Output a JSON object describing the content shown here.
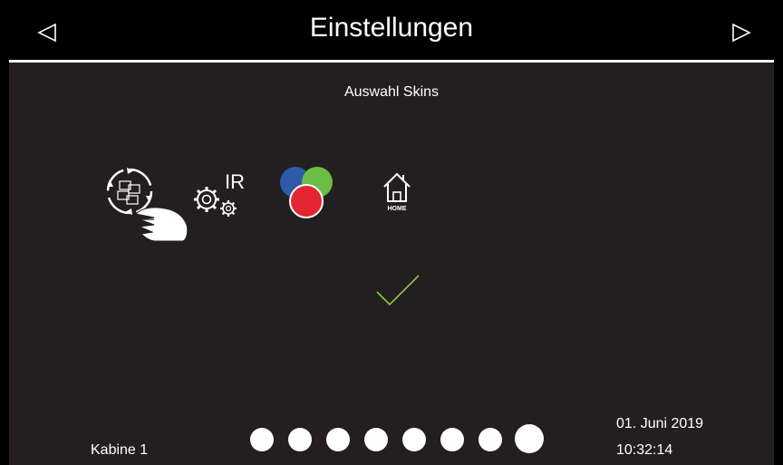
{
  "header": {
    "title": "Einstellungen",
    "prev_icon": "triangle-left-icon",
    "next_icon": "triangle-right-icon"
  },
  "main": {
    "subtitle": "Auswahl Skins",
    "skins": [
      {
        "name": "skin-swipe",
        "icon": "swipe-hand-icon"
      },
      {
        "name": "skin-ir",
        "icon": "gears-icon",
        "label": "IR"
      },
      {
        "name": "skin-color",
        "icon": "color-circles-icon"
      },
      {
        "name": "skin-home",
        "icon": "home-icon",
        "label": "HOME"
      }
    ],
    "check_icon": "checkmark-icon",
    "check_color": "#8dc63f"
  },
  "footer": {
    "cabin": "Kabine 1",
    "date": "01. Juni 2019",
    "time": "10:32:14",
    "page_count": 8,
    "active_page": 8
  },
  "colors": {
    "background": "#231f20",
    "header": "#000000",
    "blue": "#2e5aa8",
    "green": "#6bbd45",
    "red": "#e3262f"
  }
}
